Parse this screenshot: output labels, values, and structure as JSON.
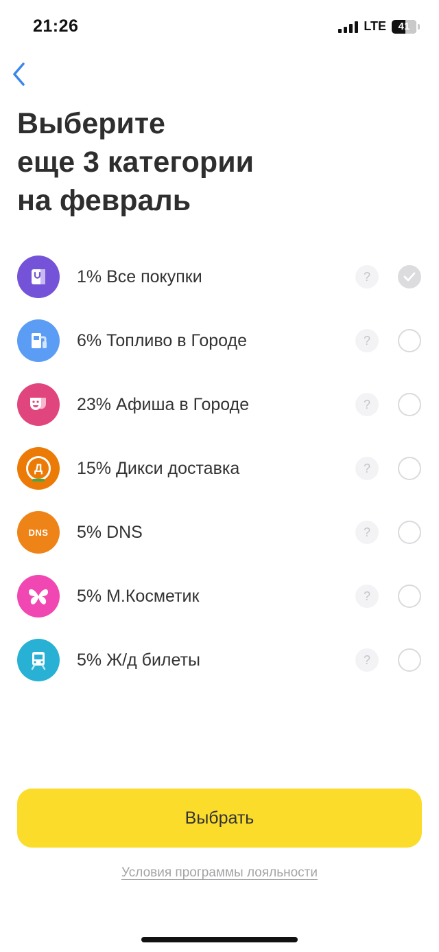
{
  "status_bar": {
    "time": "21:26",
    "network": "LTE",
    "battery": "41"
  },
  "header": {
    "back_icon": "chevron-left-icon",
    "title": "Выберите\nеще 3 категории\nна февраль"
  },
  "categories": [
    {
      "label": "1% Все покупки",
      "icon": "shopping-bag-icon",
      "color": "#7553d8",
      "selected": true
    },
    {
      "label": "6% Топливо в Городе",
      "icon": "fuel-pump-icon",
      "color": "#5b9cf5",
      "selected": false
    },
    {
      "label": "23% Афиша в Городе",
      "icon": "theatre-mask-icon",
      "color": "#e0457d",
      "selected": false
    },
    {
      "label": "15% Дикси доставка",
      "icon": "dixy-logo-icon",
      "color": "#ec7a07",
      "selected": false
    },
    {
      "label": "5% DNS",
      "icon": "dns-logo-icon",
      "color": "#ee8418",
      "selected": false,
      "logo_text": "DNS"
    },
    {
      "label": "5% М.Косметик",
      "icon": "butterfly-icon",
      "color": "#f147b3",
      "selected": false
    },
    {
      "label": "5% Ж/д билеты",
      "icon": "train-icon",
      "color": "#28b1d4",
      "selected": false
    }
  ],
  "help_symbol": "?",
  "dixy_letter": "Д",
  "actions": {
    "select_label": "Выбрать",
    "terms_label": "Условия программы лояльности"
  },
  "colors": {
    "accent_yellow": "#fbdc2b",
    "back_blue": "#3a86ee"
  }
}
